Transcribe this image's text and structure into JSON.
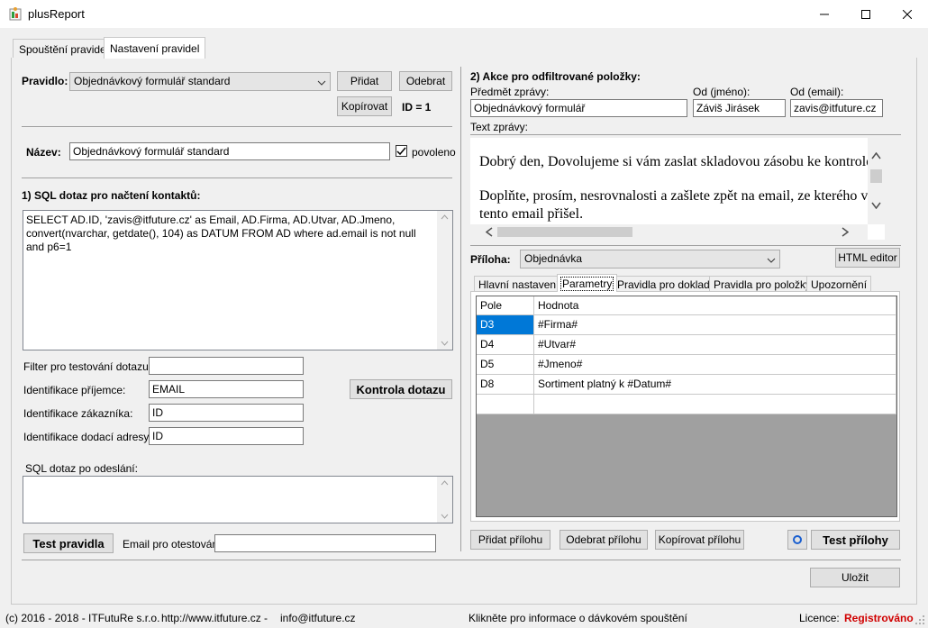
{
  "window": {
    "title": "plusReport"
  },
  "tabs": [
    {
      "label": "Spouštění pravidel"
    },
    {
      "label": "Nastavení pravidel"
    }
  ],
  "rule": {
    "label": "Pravidlo:",
    "selected": "Objednávkový formulář standard",
    "add_label": "Přidat",
    "remove_label": "Odebrat",
    "copy_label": "Kopírovat",
    "id_text": "ID = 1"
  },
  "name": {
    "label": "Název:",
    "value": "Objednávkový formulář standard",
    "enabled_label": "povoleno",
    "enabled": true
  },
  "sql": {
    "heading": "1) SQL dotaz pro načtení kontaktů:",
    "query": "SELECT AD.ID, 'zavis@itfuture.cz' as Email, AD.Firma, AD.Utvar, AD.Jmeno, convert(nvarchar, getdate(), 104) as DATUM FROM AD where ad.email is not null and p6=1",
    "filter_label": "Filter pro testování dotazu:",
    "filter_value": "",
    "recipient_label": "Identifikace příjemce:",
    "recipient_value": "EMAIL",
    "customer_label": "Identifikace zákazníka:",
    "customer_value": "ID",
    "delivery_label": "Identifikace dodací adresy:",
    "delivery_value": "ID",
    "check_button": "Kontrola dotazu",
    "after_send_label": "SQL dotaz po odeslání:",
    "after_send_value": "",
    "test_rule_button": "Test pravidla",
    "test_email_label": "Email pro otestování:",
    "test_email_value": ""
  },
  "action": {
    "heading": "2) Akce pro odfiltrované položky:",
    "subject_label": "Předmět zprávy:",
    "subject_value": "Objednávkový formulář",
    "from_name_label": "Od (jméno):",
    "from_name_value": "Záviš Jirásek",
    "from_email_label": "Od (email):",
    "from_email_value": "zavis@itfuture.cz",
    "text_label": "Text zprávy:",
    "text_line1": "Dobrý den, Dovolujeme si vám zaslat skladovou zásobu ke kontrole.",
    "text_line2": "Doplňte, prosím, nesrovnalosti a zašlete zpět na email, ze kterého vám",
    "text_line3": "tento email přišel."
  },
  "attachment": {
    "label": "Příloha:",
    "selected": "Objednávka",
    "html_editor_button": "HTML editor",
    "subtabs": [
      "Hlavní nastavení",
      "Parametry",
      "Pravidla pro doklady",
      "Pravidla pro položky",
      "Upozornění"
    ],
    "grid": {
      "headers": [
        "Pole",
        "Hodnota"
      ],
      "rows": [
        {
          "pole": "D3",
          "hodnota": "#Firma#"
        },
        {
          "pole": "D4",
          "hodnota": "#Utvar#"
        },
        {
          "pole": "D5",
          "hodnota": "#Jmeno#"
        },
        {
          "pole": "D8",
          "hodnota": "Sortiment platný k #Datum#"
        }
      ]
    },
    "add_button": "Přidat přílohu",
    "remove_button": "Odebrat přílohu",
    "copy_button": "Kopírovat přílohu",
    "test_button": "Test přílohy"
  },
  "save_button": "Uložit",
  "status": {
    "copyright": "(c) 2016 - 2018 - ITFutuRe s.r.o.",
    "website": "http://www.itfuture.cz -",
    "email": "info@itfuture.cz",
    "batch_info": "Klikněte pro informace o dávkovém spouštění",
    "licence_label": "Licence:",
    "licence_value": "Registrováno",
    "licence_color": "#d00000"
  },
  "colors": {
    "selection": "#0078d7",
    "grid_empty": "#a0a0a0"
  }
}
